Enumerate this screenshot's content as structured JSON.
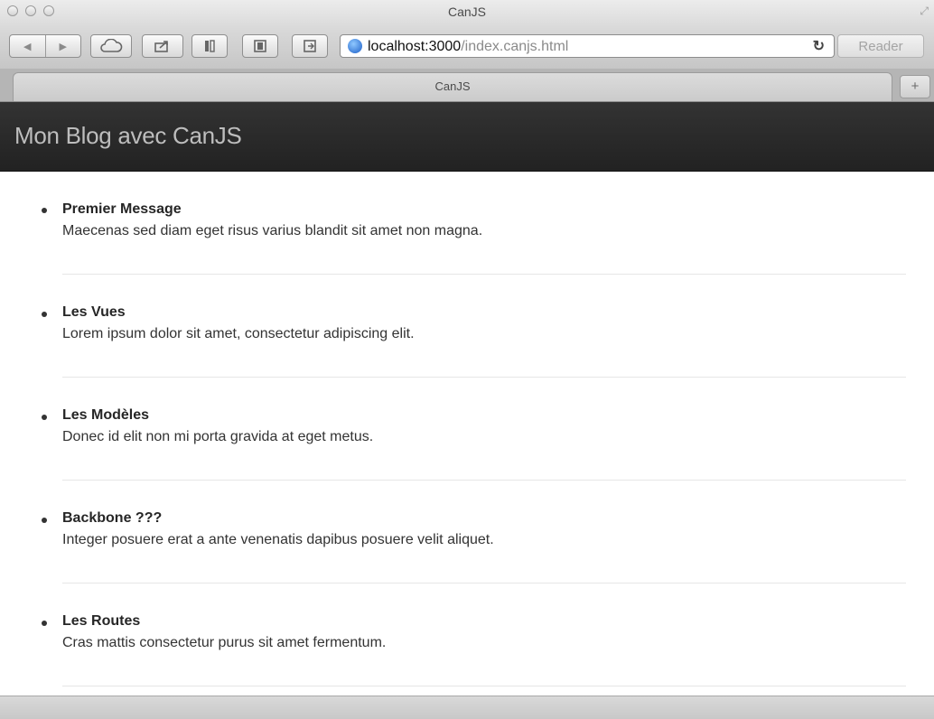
{
  "window": {
    "title": "CanJS"
  },
  "toolbar": {
    "back_glyph": "◀",
    "forward_glyph": "▶",
    "url_host": "localhost:3000",
    "url_path": "/index.canjs.html",
    "reader_label": "Reader"
  },
  "tabs": [
    {
      "label": "CanJS"
    }
  ],
  "navbar": {
    "brand": "Mon Blog avec CanJS"
  },
  "posts": [
    {
      "title": "Premier Message",
      "body": "Maecenas sed diam eget risus varius blandit sit amet non magna."
    },
    {
      "title": "Les Vues",
      "body": "Lorem ipsum dolor sit amet, consectetur adipiscing elit."
    },
    {
      "title": "Les Modèles",
      "body": "Donec id elit non mi porta gravida at eget metus."
    },
    {
      "title": "Backbone ???",
      "body": "Integer posuere erat a ante venenatis dapibus posuere velit aliquet."
    },
    {
      "title": "Les Routes",
      "body": "Cras mattis consectetur purus sit amet fermentum."
    }
  ]
}
